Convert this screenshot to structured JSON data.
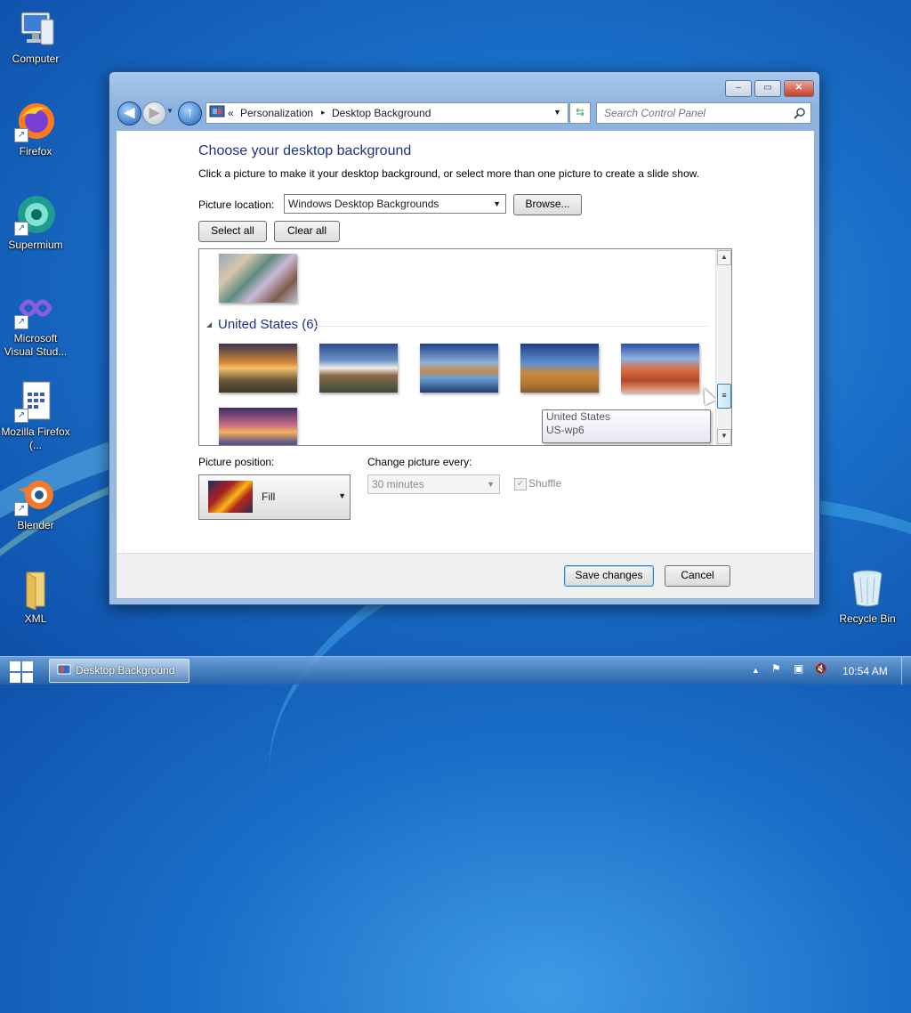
{
  "desktop": {
    "icons": [
      {
        "label": "Computer",
        "icon": "computer-icon"
      },
      {
        "label": "Firefox",
        "icon": "firefox-icon"
      },
      {
        "label": "Supermium",
        "icon": "supermium-icon"
      },
      {
        "label": "Microsoft Visual Stud...",
        "icon": "visual-studio-icon"
      },
      {
        "label": "Mozilla Firefox (...",
        "icon": "document-icon"
      },
      {
        "label": "Blender",
        "icon": "blender-icon"
      },
      {
        "label": "XML",
        "icon": "folder-icon"
      },
      {
        "label": "Recycle Bin",
        "icon": "recycle-bin-icon"
      }
    ]
  },
  "window": {
    "controls": {
      "minimize": "–",
      "maximize": "▭",
      "close": "✕"
    },
    "breadcrumb": {
      "prefix": "«",
      "items": [
        "Personalization",
        "Desktop Background"
      ],
      "separator": "▸"
    },
    "search_placeholder": "Search Control Panel",
    "title": "Choose your desktop background",
    "description": "Click a picture to make it your desktop background, or select more than one picture to create a slide show.",
    "picture_location_label": "Picture location:",
    "picture_location_value": "Windows Desktop Backgrounds",
    "browse_label": "Browse...",
    "select_all_label": "Select all",
    "clear_all_label": "Clear all",
    "group_label": "United States (6)",
    "tooltip": {
      "line1": "United States",
      "line2": "US-wp6"
    },
    "picture_position_label": "Picture position:",
    "picture_position_value": "Fill",
    "change_every_label": "Change picture every:",
    "change_every_value": "30 minutes",
    "shuffle_label": "Shuffle",
    "shuffle_checked": true,
    "save_label": "Save changes",
    "cancel_label": "Cancel"
  },
  "taskbar": {
    "task_label": "Desktop Background",
    "clock": "10:54 AM",
    "tray_icons": [
      "show-hidden-icons-icon",
      "action-center-flag-icon",
      "network-icon",
      "volume-muted-icon"
    ]
  }
}
